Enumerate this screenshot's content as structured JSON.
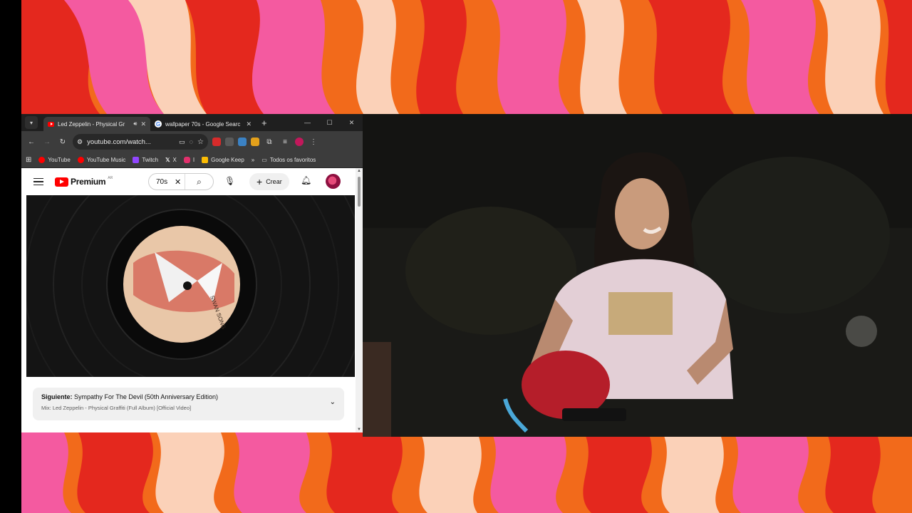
{
  "browser": {
    "tabs": [
      {
        "title": "Led Zeppelin - Physical Gr",
        "active": true,
        "favicon": "youtube-icon"
      },
      {
        "title": "wallpaper 70s - Google Searc",
        "active": false,
        "favicon": "google-icon"
      }
    ],
    "new_tab_symbol": "+",
    "url": "youtube.com/watch...",
    "bookmarks": [
      {
        "label": "YouTube",
        "color": "#ff0000"
      },
      {
        "label": "YouTube Music",
        "color": "#ff0000"
      },
      {
        "label": "Twitch",
        "color": "#9146ff"
      },
      {
        "label": "X",
        "color": "#111111"
      },
      {
        "label": "I",
        "color": "#e1306c"
      },
      {
        "label": "Google Keep",
        "color": "#fbbc04"
      }
    ],
    "bookmarks_overflow": "»",
    "all_bookmarks_label": "Todos os favoritos"
  },
  "youtube": {
    "brand": "Premium",
    "country_code": "AR",
    "search_query": "70s",
    "create_label": "Crear",
    "next_label": "Siguiente:",
    "next_title": "Sympathy For The Devil (50th Anniversary Edition)",
    "mix_label": "Mix: Led Zeppelin - Physical Graffiti (Full Album) [Official Video]",
    "record_label_text": "SWAN SONG"
  },
  "colors": {
    "youtube_red": "#ff0000",
    "wallpaper_orange": "#f26a1b",
    "wallpaper_pink": "#f45aa0",
    "wallpaper_red": "#e4281e",
    "wallpaper_peach": "#fbd1b8"
  }
}
